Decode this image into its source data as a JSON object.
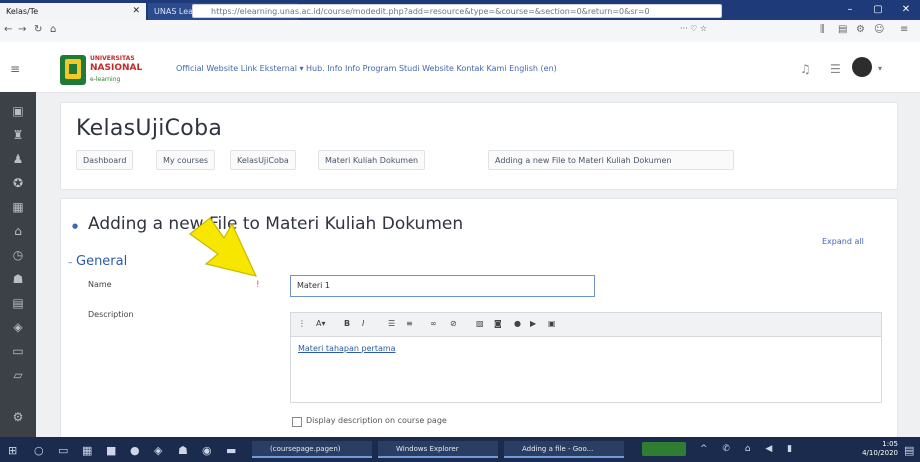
{
  "browser": {
    "tabs": [
      {
        "label": "Kelas/Te",
        "active": true
      },
      {
        "label": "UNAS Learning",
        "active": false
      }
    ],
    "url": "https://elearning.unas.ac.id/course/modedit.php?add=resource&type=&course=&section=0&return=0&sr=0"
  },
  "site": {
    "logo_line1": "UNIVERSITAS",
    "logo_line2": "NASIONAL",
    "logo_line3": "e-learning",
    "menu": "Official Website   Link Eksternal ▾   Hub. Info   Info Program Studi   Website   Kontak Kami   English (en)"
  },
  "course": {
    "title": "KelasUjiCoba",
    "breadcrumbs": [
      "Dashboard",
      "My courses",
      "KelasUjiCoba",
      "Materi Kuliah Dokumen",
      "Adding a new File to Materi Kuliah Dokumen"
    ]
  },
  "form": {
    "page_title": "Adding a new File to Materi Kuliah Dokumen",
    "expand_all": "Expand all",
    "section_general": "General",
    "name_label": "Name",
    "name_value": "Materi 1",
    "description_label": "Description",
    "editor_text": "Materi tahapan pertama",
    "display_checkbox_label": "Display description on course page"
  },
  "taskbar": {
    "apps": [
      "(coursepage.pagen)",
      "Windows Explorer",
      "Adding a file - Goo..."
    ],
    "time": "1:05",
    "date": "4/10/2020"
  },
  "colors": {
    "accent": "#2b5aa8",
    "sidebar": "#3c4147",
    "arrow": "#f7e600"
  }
}
